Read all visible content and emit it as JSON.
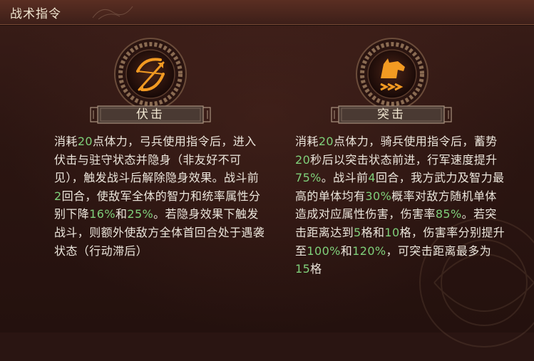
{
  "header": {
    "title": "战术指令"
  },
  "skills": [
    {
      "name": "伏击",
      "icon": "bow-arrow-icon",
      "description": [
        {
          "t": "消耗"
        },
        {
          "t": "20",
          "hl": true
        },
        {
          "t": "点体力，弓兵使用指令后，进入伏击与驻守状态并隐身（非友好不可见），触发战斗后解除隐身效果。战斗前"
        },
        {
          "t": "2",
          "hl": true
        },
        {
          "t": "回合，使敌军全体的智力和统率属性分别下降"
        },
        {
          "t": "16%",
          "hl": true
        },
        {
          "t": "和"
        },
        {
          "t": "25%",
          "hl": true
        },
        {
          "t": "。若隐身效果下触发战斗，则额外使敌方全体首回合处于遇袭状态（行动滞后）"
        }
      ]
    },
    {
      "name": "突击",
      "icon": "horse-head-icon",
      "description": [
        {
          "t": "消耗"
        },
        {
          "t": "20",
          "hl": true
        },
        {
          "t": "点体力，骑兵使用指令后，蓄势"
        },
        {
          "t": "20",
          "hl": true
        },
        {
          "t": "秒后以突击状态前进，行军速度提升"
        },
        {
          "t": "75%",
          "hl": true
        },
        {
          "t": "。战斗前"
        },
        {
          "t": "4",
          "hl": true
        },
        {
          "t": "回合，我方武力及智力最高的单体均有"
        },
        {
          "t": "30%",
          "hl": true
        },
        {
          "t": "概率对敌方随机单体造成对应属性伤害，伤害率"
        },
        {
          "t": "85%",
          "hl": true
        },
        {
          "t": "。若突击距离达到"
        },
        {
          "t": "5",
          "hl": true
        },
        {
          "t": "格和"
        },
        {
          "t": "10",
          "hl": true
        },
        {
          "t": "格，伤害率分别提升至"
        },
        {
          "t": "100%",
          "hl": true
        },
        {
          "t": "和"
        },
        {
          "t": "120%",
          "hl": true
        },
        {
          "t": "，可突击距离最多为"
        },
        {
          "t": "15",
          "hl": true
        },
        {
          "t": "格"
        }
      ]
    }
  ],
  "colors": {
    "highlight": "#7fd07a",
    "text": "#ece6dc",
    "icon_orange": "#f29a22",
    "frame": "#7a5a44"
  }
}
